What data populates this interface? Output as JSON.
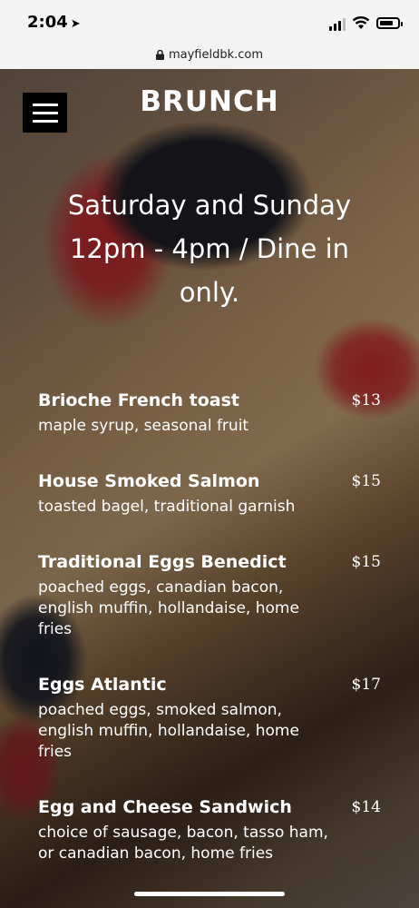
{
  "status_bar": {
    "time": "2:04",
    "battery_level": 0.8
  },
  "browser": {
    "url": "mayfieldbk.com"
  },
  "page": {
    "title": "BRUNCH",
    "hours": "Saturday and Sunday 12pm - 4pm / Dine in only."
  },
  "menu_items": [
    {
      "name": "Brioche French toast",
      "price": "$13",
      "desc": "maple syrup, seasonal fruit"
    },
    {
      "name": "House Smoked Salmon",
      "price": "$15",
      "desc": "toasted bagel, traditional garnish"
    },
    {
      "name": "Traditional Eggs Benedict",
      "price": "$15",
      "desc": "poached eggs, canadian bacon, english muffin, hollandaise, home fries"
    },
    {
      "name": "Eggs Atlantic",
      "price": "$17",
      "desc": "poached eggs, smoked salmon, english muffin, hollandaise, home fries"
    },
    {
      "name": "Egg and Cheese Sandwich",
      "price": "$14",
      "desc": "choice of sausage, bacon, tasso ham, or canadian bacon, home fries"
    }
  ],
  "icons": {
    "location": "location-arrow-icon",
    "signal": "cellular-signal-icon",
    "wifi": "wifi-icon",
    "battery": "battery-icon",
    "lock": "lock-icon",
    "menu": "hamburger-menu-icon"
  }
}
